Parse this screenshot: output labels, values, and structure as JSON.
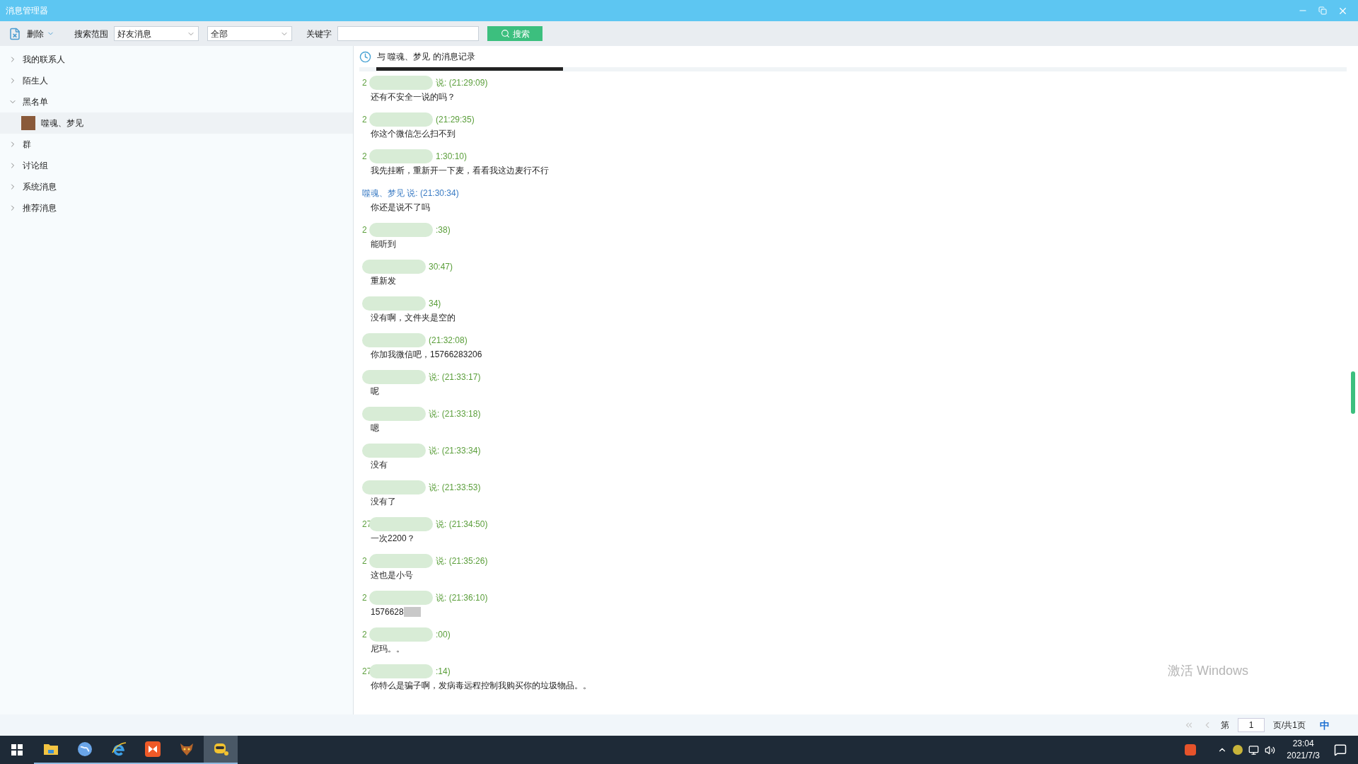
{
  "window": {
    "title": "消息管理器"
  },
  "toolbar": {
    "delete_label": "删除",
    "scope_label": "搜索范围",
    "scope_select": "好友消息",
    "type_select": "全部",
    "keyword_label": "关键字",
    "search_button": "搜索"
  },
  "sidebar": {
    "items": [
      {
        "label": "我的联系人",
        "expanded": false
      },
      {
        "label": "陌生人",
        "expanded": false
      },
      {
        "label": "黑名单",
        "expanded": true,
        "children": [
          {
            "label": "噬魂、梦见",
            "selected": true
          }
        ]
      },
      {
        "label": "群",
        "expanded": false
      },
      {
        "label": "讨论组",
        "expanded": false
      },
      {
        "label": "系统消息",
        "expanded": false
      },
      {
        "label": "推荐消息",
        "expanded": false
      }
    ]
  },
  "history": {
    "title": "与 噬魂、梦见 的消息记录",
    "messages": [
      {
        "kind": "self",
        "prefix": "2",
        "header": "说: (21:29:09)",
        "body": "还有不安全一说的吗？"
      },
      {
        "kind": "self",
        "prefix": "2",
        "header": "(21:29:35)",
        "body": "你这个微信怎么扫不到"
      },
      {
        "kind": "self",
        "prefix": "2",
        "header": "1:30:10)",
        "body": "我先挂断，重新开一下麦，看看我这边麦行不行"
      },
      {
        "kind": "other",
        "header": "噬魂、梦见 说: (21:30:34)",
        "body": "你还是说不了吗"
      },
      {
        "kind": "self",
        "prefix": "2",
        "header": ":38)",
        "body": "能听到"
      },
      {
        "kind": "self",
        "header": "30:47)",
        "body": "重新发"
      },
      {
        "kind": "self",
        "header": "34)",
        "body": "没有啊，文件夹是空的"
      },
      {
        "kind": "self",
        "header": "(21:32:08)",
        "body": "你加我微信吧，15766283206"
      },
      {
        "kind": "self",
        "header": "说: (21:33:17)",
        "body": "呢"
      },
      {
        "kind": "self",
        "header": "说: (21:33:18)",
        "body": "嗯"
      },
      {
        "kind": "self",
        "header": "说: (21:33:34)",
        "body": "没有"
      },
      {
        "kind": "self",
        "header": "说: (21:33:53)",
        "body": "没有了"
      },
      {
        "kind": "self",
        "prefix": "27",
        "header": "说: (21:34:50)",
        "body": "一次2200？"
      },
      {
        "kind": "self",
        "prefix": "2",
        "header": "说: (21:35:26)",
        "body": "这也是小号"
      },
      {
        "kind": "self",
        "prefix": "2",
        "header": "说: (21:36:10)",
        "body": "1576628",
        "redacted_tail": true
      },
      {
        "kind": "self",
        "prefix": "2",
        "header": ":00)",
        "body": "尼玛。。"
      },
      {
        "kind": "self",
        "prefix": "27",
        "header": ":14)",
        "body": "你特么是骗子啊，发病毒远程控制我购买你的垃圾物品。。"
      }
    ]
  },
  "pagination": {
    "prefix": "第",
    "page": "1",
    "suffix": "页/共1页"
  },
  "activation_notice": "激活 Windows",
  "ime_indicator": "中",
  "taskbar": {
    "apps": [
      {
        "kind": "folder",
        "selected": false
      },
      {
        "kind": "globe",
        "selected": false
      },
      {
        "kind": "ie",
        "selected": false
      },
      {
        "kind": "player",
        "selected": false
      },
      {
        "kind": "game",
        "selected": false
      },
      {
        "kind": "mascot",
        "selected": true
      }
    ],
    "time": "23:04",
    "date": "2021/7/3"
  }
}
